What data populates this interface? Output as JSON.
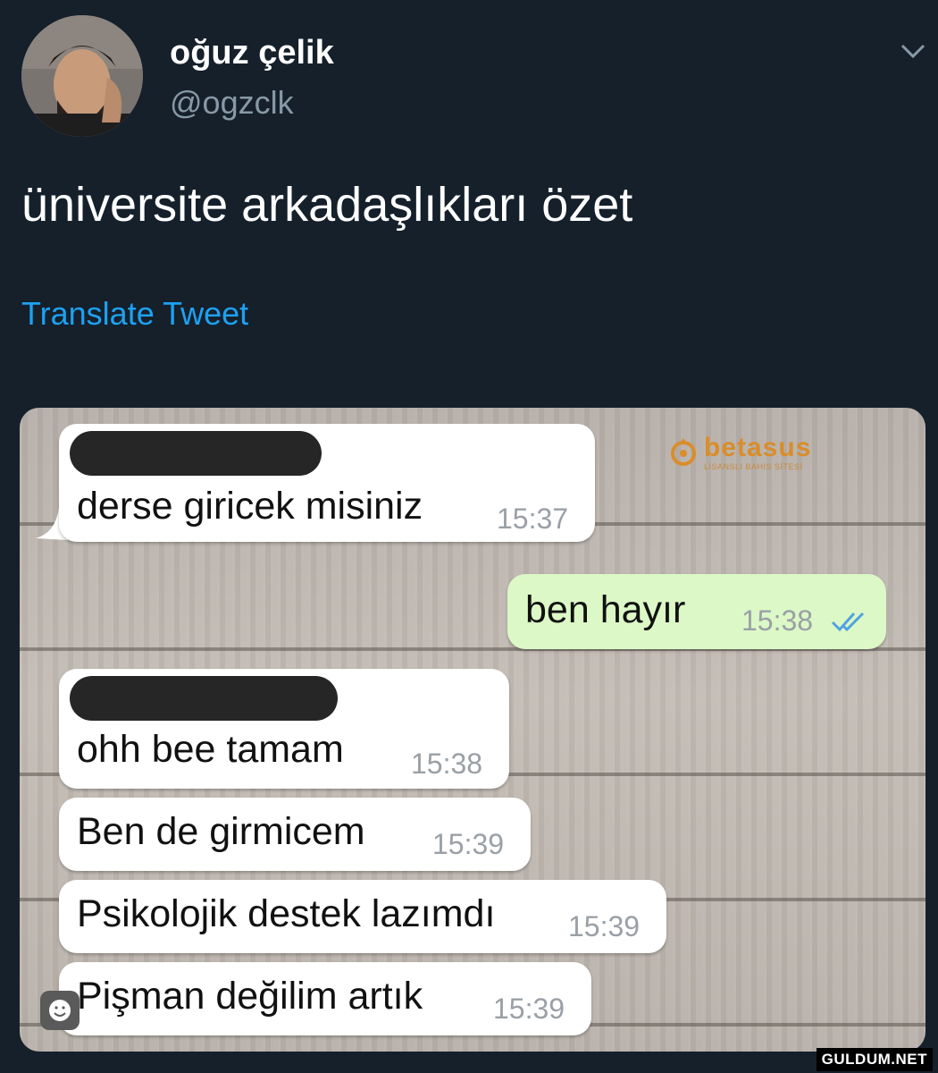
{
  "tweet": {
    "author_name": "oğuz çelik",
    "author_handle": "@ogzclk",
    "text": "üniversite arkadaşlıkları özet",
    "translate_label": "Translate Tweet",
    "menu_icon": "chevron-down-icon"
  },
  "chat": {
    "messages": [
      {
        "direction": "incoming",
        "text": "derse giricek misiniz",
        "time": "15:37",
        "sender_redacted": true
      },
      {
        "direction": "outgoing",
        "text": "ben hayır",
        "time": "15:38",
        "status_icon": "double-check-icon"
      },
      {
        "direction": "incoming",
        "text": "ohh bee tamam",
        "time": "15:38",
        "sender_redacted": true
      },
      {
        "direction": "incoming",
        "text": "Ben de girmicem",
        "time": "15:39"
      },
      {
        "direction": "incoming",
        "text": "Psikolojik destek lazımdı",
        "time": "15:39"
      },
      {
        "direction": "incoming",
        "text": "Pişman değilim artık",
        "time": "15:39"
      }
    ],
    "overlay_logo": {
      "name": "betasus",
      "tagline": "LİSANSLI BAHİS SİTESİ"
    },
    "emoji_icon": "smiley-icon"
  },
  "watermark": "GULDUM.NET",
  "colors": {
    "background": "#15202b",
    "link": "#1da1f2",
    "secondary_text": "#8899a6",
    "outgoing_bubble": "#dcf8c6",
    "read_ticks": "#4fa3e0"
  }
}
